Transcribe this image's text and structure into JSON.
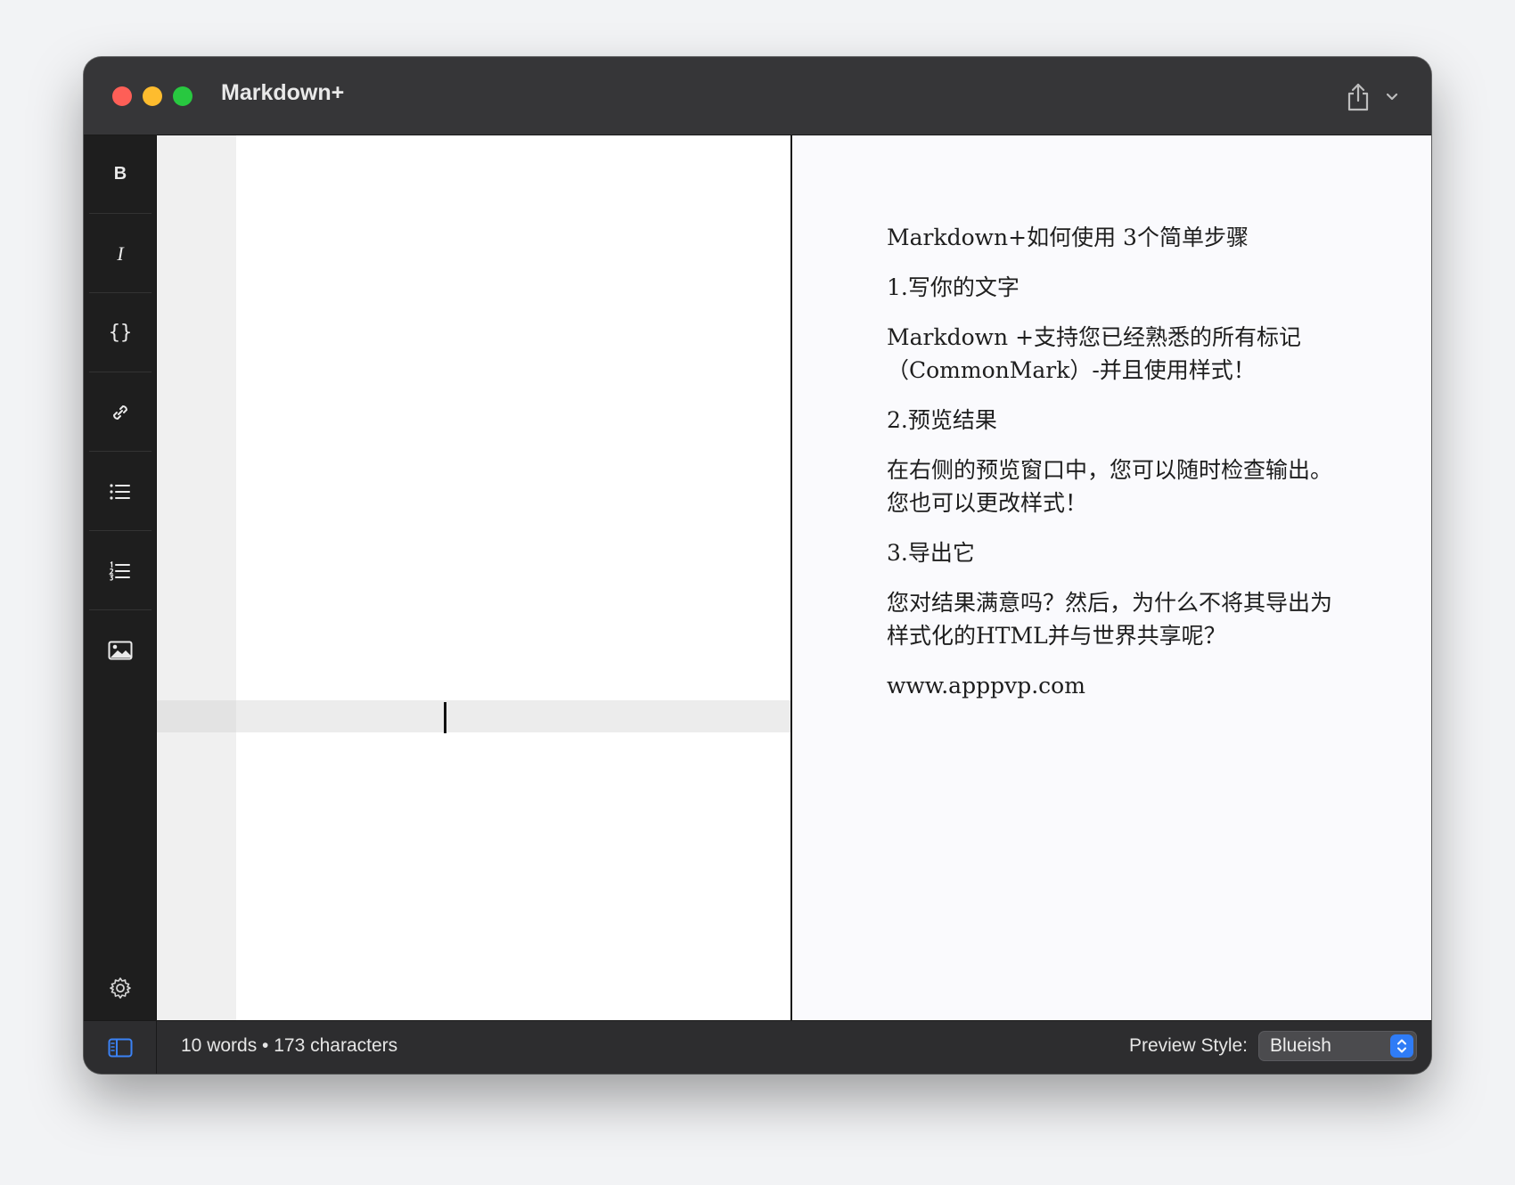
{
  "window": {
    "title": "Markdown+"
  },
  "toolbar": {
    "bold_label": "B",
    "italic_label": "I",
    "code_label": "{}",
    "icons": [
      "link-icon",
      "bullet-list-icon",
      "numbered-list-icon",
      "image-icon",
      "gear-icon",
      "share-icon",
      "chevron-down-icon",
      "sidebar-toggle-icon"
    ]
  },
  "preview": {
    "paragraphs": [
      "Markdown+如何使用 3个简单步骤",
      "1.写你的文字",
      "Markdown +支持您已经熟悉的所有标记（CommonMark）-并且使用样式！",
      "2.预览结果",
      "在右侧的预览窗口中，您可以随时检查输出。您也可以更改样式！",
      "3.导出它",
      "您对结果满意吗？然后，为什么不将其导出为样式化的HTML并与世界共享呢？",
      "www.apppvp.com"
    ]
  },
  "statusbar": {
    "counts": "10 words • 173 characters",
    "preview_style_label": "Preview Style:",
    "preview_style_value": "Blueish"
  },
  "colors": {
    "accent": "#2f7cf6",
    "close": "#fe5f57",
    "minimize": "#febc2e",
    "maximize": "#28c840"
  }
}
